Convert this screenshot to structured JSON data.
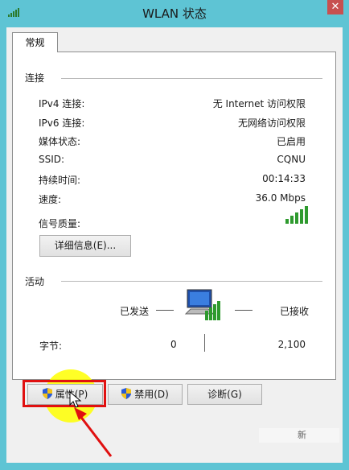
{
  "window": {
    "title": "WLAN 状态",
    "close_label": "✕"
  },
  "tabs": [
    {
      "label": "常规"
    }
  ],
  "connection": {
    "section_label": "连接",
    "rows": [
      {
        "label": "IPv4 连接:",
        "value": "无 Internet 访问权限"
      },
      {
        "label": "IPv6 连接:",
        "value": "无网络访问权限"
      },
      {
        "label": "媒体状态:",
        "value": "已启用"
      },
      {
        "label": "SSID:",
        "value": "CQNU"
      },
      {
        "label": "持续时间:",
        "value": "00:14:33"
      },
      {
        "label": "速度:",
        "value": "36.0 Mbps"
      },
      {
        "label": "信号质量:",
        "value": ""
      }
    ],
    "signal_icon": "signal-bars-icon",
    "details_button": "详细信息(E)..."
  },
  "activity": {
    "section_label": "活动",
    "sent_label": "已发送",
    "received_label": "已接收",
    "bytes_label": "字节:",
    "bytes_sent": "0",
    "bytes_received": "2,100",
    "network_icon": "network-computer-icon"
  },
  "buttons": {
    "properties": "属性(P)",
    "disable": "禁用(D)",
    "diagnose": "诊断(G)"
  },
  "watermark": {
    "text": "新"
  },
  "colors": {
    "window_frame": "#5ec4d4",
    "highlight_box": "#e01010",
    "cursor_highlight": "#ffff00",
    "arrow": "#e01010",
    "signal_green": "#2e9a2e"
  }
}
